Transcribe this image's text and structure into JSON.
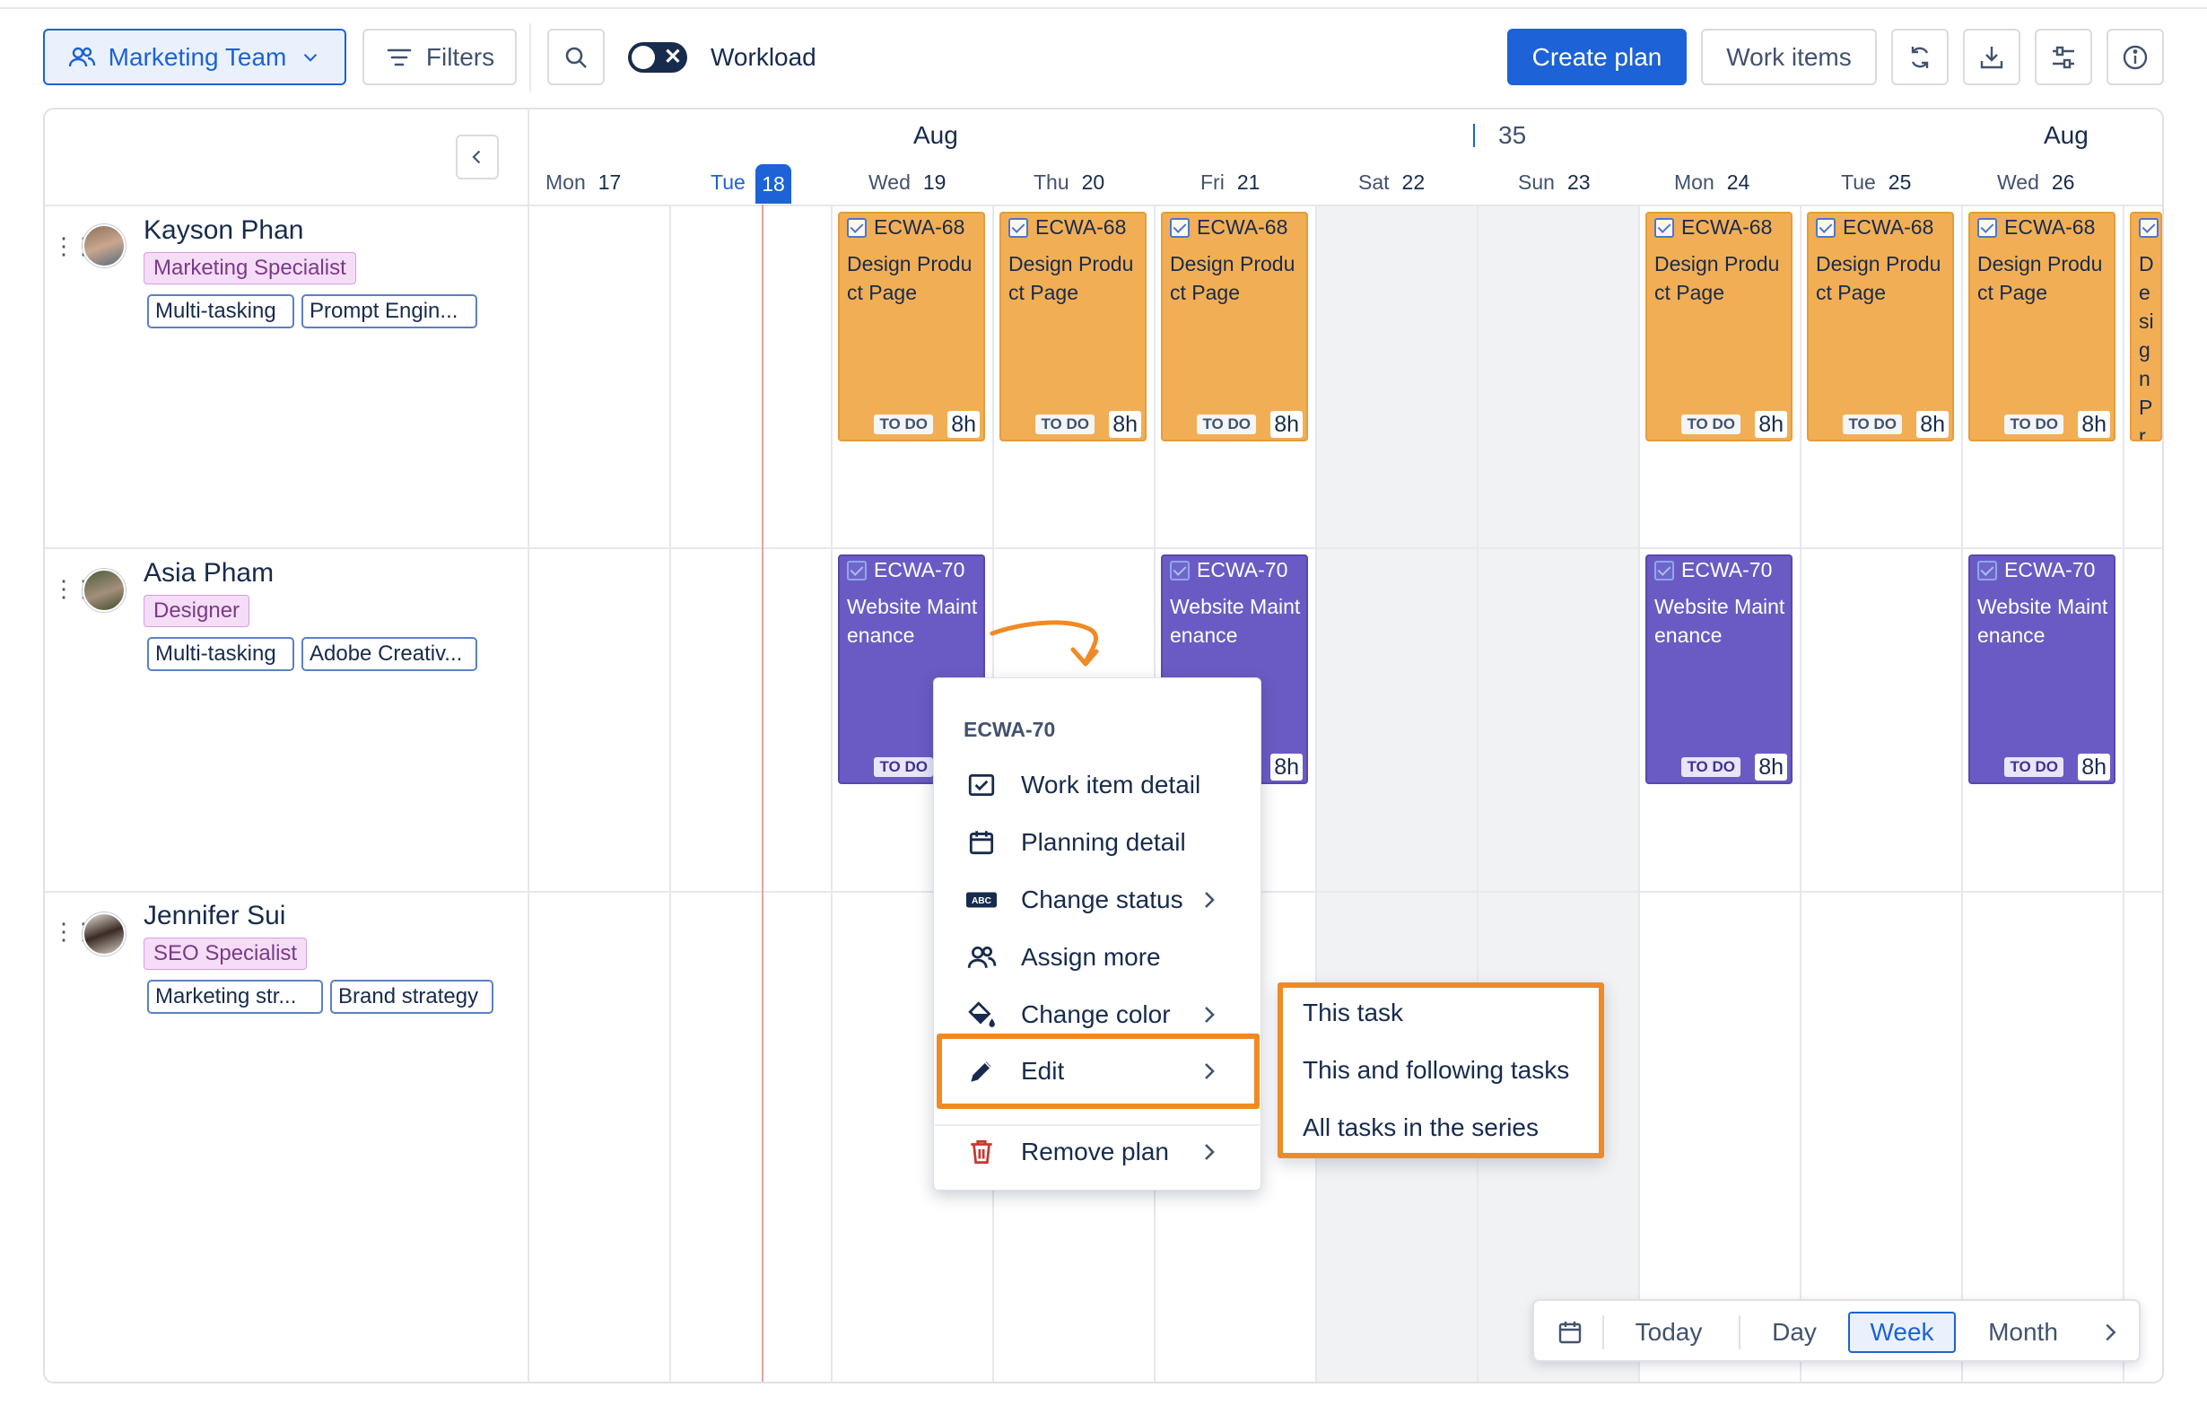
{
  "toolbar": {
    "team_label": "Marketing Team",
    "filters_label": "Filters",
    "workload_label": "Workload",
    "workload_enabled": false,
    "create_plan_label": "Create plan",
    "work_items_label": "Work items",
    "icons": [
      "refresh-icon",
      "download-icon",
      "settings-sliders-icon",
      "info-icon"
    ]
  },
  "timeline": {
    "month_left": "Aug",
    "week_number": "35",
    "month_right": "Aug",
    "days": [
      {
        "name": "Mon",
        "num": "17"
      },
      {
        "name": "Tue",
        "num": "18",
        "today": true
      },
      {
        "name": "Wed",
        "num": "19"
      },
      {
        "name": "Thu",
        "num": "20"
      },
      {
        "name": "Fri",
        "num": "21"
      },
      {
        "name": "Sat",
        "num": "22",
        "weekend": true
      },
      {
        "name": "Sun",
        "num": "23",
        "weekend": true
      },
      {
        "name": "Mon",
        "num": "24"
      },
      {
        "name": "Tue",
        "num": "25"
      },
      {
        "name": "Wed",
        "num": "26"
      }
    ]
  },
  "people": [
    {
      "name": "Kayson Phan",
      "role": "Marketing Specialist",
      "skills": [
        "Multi-tasking",
        "Prompt Engin..."
      ]
    },
    {
      "name": "Asia Pham",
      "role": "Designer",
      "skills": [
        "Multi-tasking",
        "Adobe Creativ..."
      ]
    },
    {
      "name": "Jennifer Sui",
      "role": "SEO Specialist",
      "skills": [
        "Marketing str...",
        "Brand strategy"
      ]
    }
  ],
  "tasks": {
    "design": {
      "key": "ECWA-68",
      "title": "Design Product Page",
      "status": "TO DO",
      "hours": "8h",
      "color": "#f2ae55"
    },
    "website": {
      "key": "ECWA-70",
      "title": "Website Maintenance",
      "status": "TO DO",
      "hours": "8h",
      "color": "#6a5bc4"
    }
  },
  "context_menu": {
    "header": "ECWA-70",
    "items": [
      {
        "label": "Work item detail",
        "icon": "checkbox-icon"
      },
      {
        "label": "Planning detail",
        "icon": "calendar-icon"
      },
      {
        "label": "Change status",
        "icon": "abc-icon",
        "submenu": true
      },
      {
        "label": "Assign more",
        "icon": "people-icon"
      },
      {
        "label": "Change color",
        "icon": "paint-bucket-icon",
        "submenu": true
      },
      {
        "label": "Edit",
        "icon": "pencil-icon",
        "submenu": true,
        "highlighted": true
      },
      {
        "label": "Remove plan",
        "icon": "trash-icon",
        "submenu": true
      }
    ]
  },
  "edit_submenu": {
    "items": [
      "This task",
      "This and following tasks",
      "All tasks in the series"
    ]
  },
  "view_nav": {
    "today": "Today",
    "day": "Day",
    "week": "Week",
    "month": "Month",
    "active": "Week"
  },
  "colors": {
    "accent": "#1d62d6",
    "highlight": "#f08a24",
    "task_orange": "#f2ae55",
    "task_purple": "#6a5bc4"
  }
}
